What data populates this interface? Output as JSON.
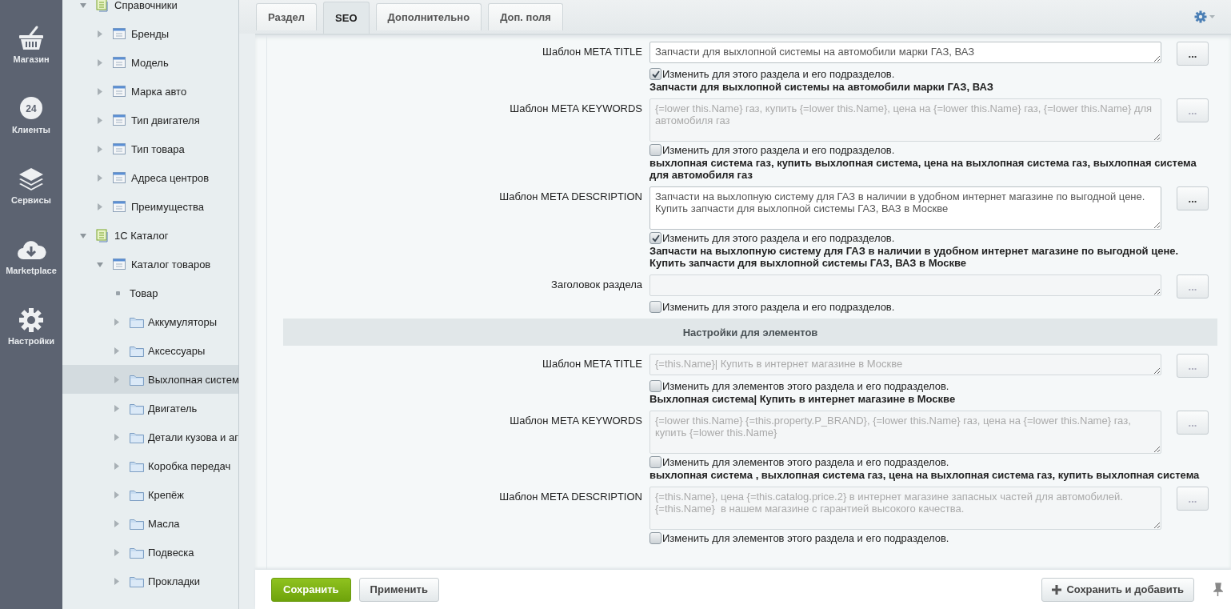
{
  "nav": [
    {
      "label": "Магазин",
      "kind": "basket"
    },
    {
      "label": "Клиенты",
      "kind": "cloud24",
      "badge": "24"
    },
    {
      "label": "Сервисы",
      "kind": "layers"
    },
    {
      "label": "Marketplace",
      "kind": "download"
    },
    {
      "label": "Настройки",
      "kind": "gear"
    }
  ],
  "tree": [
    {
      "label": "Справочники",
      "kind": "catalog",
      "expanded": true,
      "selected": false,
      "children": [
        {
          "label": "Бренды",
          "kind": "iblock",
          "expanded": false,
          "selected": false
        },
        {
          "label": "Модель",
          "kind": "iblock",
          "expanded": false,
          "selected": false
        },
        {
          "label": "Марка авто",
          "kind": "iblock",
          "expanded": false,
          "selected": false
        },
        {
          "label": "Тип двигателя",
          "kind": "iblock",
          "expanded": false,
          "selected": false
        },
        {
          "label": "Тип товара",
          "kind": "iblock",
          "expanded": false,
          "selected": false
        },
        {
          "label": "Адреса центров",
          "kind": "iblock",
          "expanded": false,
          "selected": false
        },
        {
          "label": "Преимущества",
          "kind": "iblock",
          "expanded": false,
          "selected": false
        }
      ]
    },
    {
      "label": "1С Каталог",
      "kind": "catalog",
      "expanded": true,
      "selected": false,
      "children": [
        {
          "label": "Каталог товаров",
          "kind": "iblock",
          "expanded": true,
          "selected": false,
          "children": [
            {
              "label": "Товар",
              "kind": "element",
              "selected": false
            },
            {
              "label": "Аккумуляторы",
              "kind": "folder",
              "expanded": false,
              "selected": false
            },
            {
              "label": "Аксессуары",
              "kind": "folder",
              "expanded": false,
              "selected": false
            },
            {
              "label": "Выхлопная систем",
              "kind": "folder",
              "expanded": false,
              "selected": true
            },
            {
              "label": "Двигатель",
              "kind": "folder",
              "expanded": false,
              "selected": false
            },
            {
              "label": "Детали кузова и аг",
              "kind": "folder",
              "expanded": false,
              "selected": false
            },
            {
              "label": "Коробка передач",
              "kind": "folder",
              "expanded": false,
              "selected": false
            },
            {
              "label": "Крепёж",
              "kind": "folder",
              "expanded": false,
              "selected": false
            },
            {
              "label": "Масла",
              "kind": "folder",
              "expanded": false,
              "selected": false
            },
            {
              "label": "Подвеска",
              "kind": "folder",
              "expanded": false,
              "selected": false
            },
            {
              "label": "Прокладки",
              "kind": "folder",
              "expanded": false,
              "selected": false
            }
          ]
        }
      ]
    }
  ],
  "tabs": [
    {
      "label": "Раздел",
      "selected": false
    },
    {
      "label": "SEO",
      "selected": true
    },
    {
      "label": "Дополнительно",
      "selected": false
    },
    {
      "label": "Доп. поля",
      "selected": false
    }
  ],
  "form": [
    {
      "kind": "field",
      "label": "Шаблон META TITLE",
      "multiline": false,
      "value": "Запчасти для выхлопной системы на автомобили марки ГАЗ, ВАЗ",
      "disabled": false,
      "button": "...",
      "checkbox": "Изменить для этого раздела и его подразделов.",
      "checked": true,
      "preview": "Запчасти для выхлопной системы на автомобили марки ГАЗ, ВАЗ"
    },
    {
      "kind": "field",
      "label": "Шаблон META KEYWORDS",
      "multiline": true,
      "value": "{=lower this.Name} газ, купить {=lower this.Name}, цена на {=lower this.Name} газ, {=lower this.Name} для автомобиля газ",
      "disabled": true,
      "button": "...",
      "checkbox": "Изменить для этого раздела и его подразделов.",
      "checked": false,
      "preview": "выхлопная система газ, купить выхлопная система, цена на выхлопная система газ, выхлопная система для автомобиля газ"
    },
    {
      "kind": "field",
      "label": "Шаблон META DESCRIPTION",
      "multiline": true,
      "value": "Запчасти на выхлопную систему для ГАЗ в наличии в удобном интернет магазине по выгодной цене. Купить запчасти для выхлопной системы ГАЗ, ВАЗ в Москве",
      "disabled": false,
      "button": "...",
      "checkbox": "Изменить для этого раздела и его подразделов.",
      "checked": true,
      "preview": "Запчасти на выхлопную систему для ГАЗ в наличии в удобном интернет магазине по выгодной цене. Купить запчасти для выхлопной системы ГАЗ, ВАЗ в Москве"
    },
    {
      "kind": "field",
      "label": "Заголовок раздела",
      "multiline": false,
      "disabled": true,
      "button": "...",
      "checkbox": "Изменить для этого раздела и его подразделов.",
      "checked": false
    },
    {
      "kind": "heading",
      "label": "Настройки для элементов"
    },
    {
      "kind": "field",
      "label": "Шаблон META TITLE",
      "multiline": false,
      "value": "{=this.Name}| Купить в интернет магазине в Москве",
      "disabled": true,
      "button": "...",
      "checkbox": "Изменить для элементов этого раздела и его подразделов.",
      "checked": false,
      "preview": "Выхлопная система| Купить в интернет магазине в Москве"
    },
    {
      "kind": "field",
      "label": "Шаблон META KEYWORDS",
      "multiline": true,
      "value": "{=lower this.Name} {=this.property.P_BRAND}, {=lower this.Name} газ, цена на {=lower this.Name} газ, купить {=lower this.Name}",
      "disabled": true,
      "button": "...",
      "checkbox": "Изменить для элементов этого раздела и его подразделов.",
      "checked": false,
      "preview": "выхлопная система , выхлопная система газ, цена на выхлопная система газ, купить выхлопная система"
    },
    {
      "kind": "field",
      "label": "Шаблон META DESCRIPTION",
      "multiline": true,
      "value": "{=this.Name}, цена {=this.catalog.price.2} в интернет магазине запасных частей для автомобилей. {=this.Name}  в нашем магазине с гарантией высокого качества.",
      "disabled": true,
      "button": "...",
      "checkbox": "Изменить для элементов этого раздела и его подразделов.",
      "checked": false
    }
  ],
  "footer": {
    "save": "Сохранить",
    "apply": "Применить",
    "save_add": "Сохранить и добавить"
  }
}
